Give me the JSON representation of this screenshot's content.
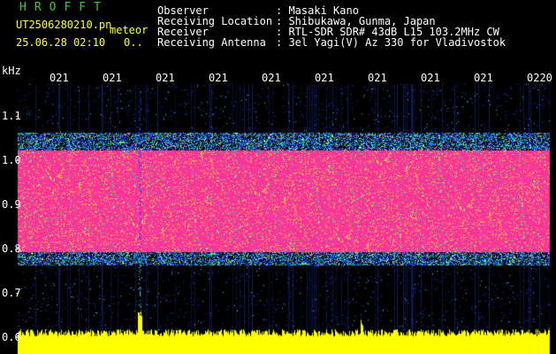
{
  "header": {
    "app_name": "HROFFT",
    "filename": "UT2506280210.pn",
    "category": "meteor",
    "datetime": "25.06.28 02:10",
    "count": "0..",
    "fields": [
      {
        "label": "Observer",
        "value": ": Masaki Kano"
      },
      {
        "label": "Receiving Location",
        "value": ": Shibukawa, Gunma, Japan"
      },
      {
        "label": "Receiver",
        "value": ": RTL-SDR SDR# 43dB L15 103.2MHz CW"
      },
      {
        "label": "Receiving Antenna",
        "value": ": 3el Yagi(V) Az 330 for Vladivostok"
      }
    ]
  },
  "axis": {
    "unit": "kHz",
    "y_ticks": [
      "1.1",
      "1.0",
      "0.9",
      "0.8",
      "0.7",
      "0.6"
    ],
    "x_ticks": [
      "021",
      "021",
      "021",
      "021",
      "021",
      "021",
      "021",
      "021",
      "021",
      "0220"
    ]
  },
  "colors": {
    "background": "#000000",
    "band_core": "#ff3399",
    "band_edge_blue": "#1a3cff",
    "band_edge_cyan": "#22ddee",
    "band_edge_green": "#33dd55",
    "band_edge_yellow": "#ffee22",
    "noise_floor": "#ffff00",
    "header_text_primary": "#ffffff",
    "header_text_accent": "#ffff33",
    "title_green": "#33cc33"
  }
}
